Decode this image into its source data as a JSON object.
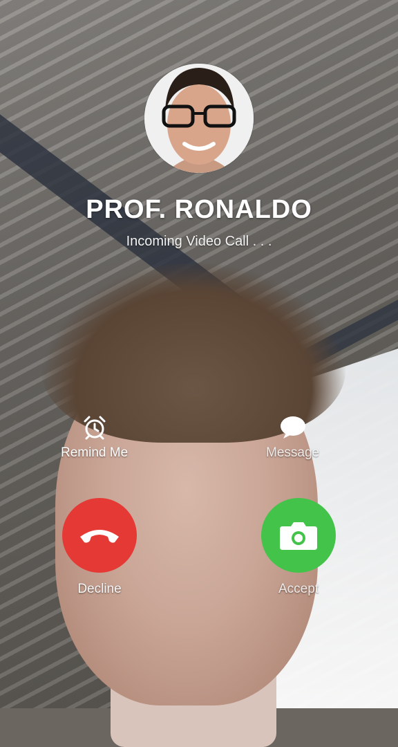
{
  "caller": {
    "name": "PROF. RONALDO",
    "status": "Incoming Video Call . . ."
  },
  "actions": {
    "remind_label": "Remind Me",
    "message_label": "Message"
  },
  "buttons": {
    "decline_label": "Decline",
    "accept_label": "Accept"
  },
  "icons": {
    "remind": "alarm-clock-icon",
    "message": "chat-bubble-icon",
    "decline": "phone-hangup-icon",
    "accept": "camera-icon"
  },
  "colors": {
    "decline": "#e53935",
    "accept": "#43c34a"
  }
}
